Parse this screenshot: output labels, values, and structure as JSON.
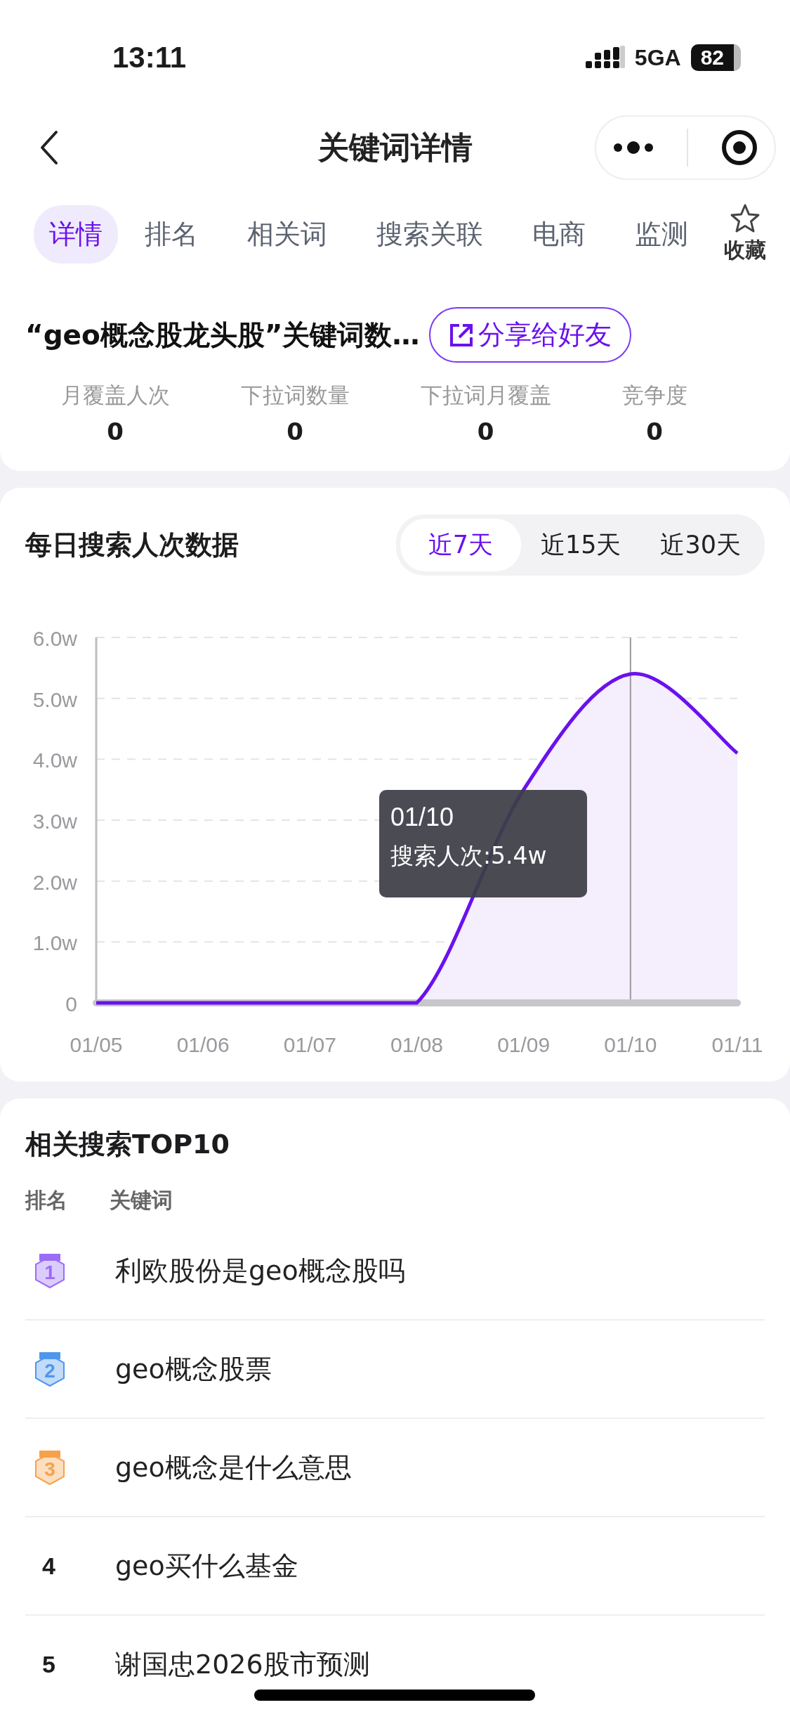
{
  "status_bar": {
    "time": "13:11",
    "network": "5GA",
    "battery": "82"
  },
  "nav": {
    "title": "关键词详情"
  },
  "tabs": [
    {
      "label": "详情",
      "selected": true
    },
    {
      "label": "排名",
      "selected": false
    },
    {
      "label": "相关词",
      "selected": false
    },
    {
      "label": "搜索关联",
      "selected": false
    },
    {
      "label": "电商",
      "selected": false
    },
    {
      "label": "监测",
      "selected": false
    }
  ],
  "favorite": {
    "label": "收藏",
    "on": false
  },
  "summary": {
    "title": "“geo概念股龙头股”关键词数…",
    "share_button": "分享给好友",
    "stats": [
      {
        "label": "月覆盖人次",
        "value": "0"
      },
      {
        "label": "下拉词数量",
        "value": "0"
      },
      {
        "label": "下拉词月覆盖",
        "value": "0"
      },
      {
        "label": "竞争度",
        "value": "0"
      }
    ]
  },
  "daily": {
    "title": "每日搜索人次数据",
    "periods": [
      {
        "label": "近7天",
        "selected": true
      },
      {
        "label": "近15天",
        "selected": false
      },
      {
        "label": "近30天",
        "selected": false
      }
    ],
    "tooltip": {
      "title": "01/10",
      "text": "搜索人次:5.4w"
    },
    "chart_data": {
      "type": "area",
      "categories": [
        "01/05",
        "01/06",
        "01/07",
        "01/08",
        "01/09",
        "01/10",
        "01/11"
      ],
      "series": [
        {
          "color": "#6a11ee",
          "values": [
            0,
            0,
            0,
            0,
            3.5,
            5.4,
            4.1
          ]
        }
      ],
      "grid": true,
      "ref_lines": [
        {
          "axis": "x",
          "value": "01/10"
        }
      ],
      "ylim": [
        0,
        6
      ],
      "yticks": [
        {
          "value": 0,
          "label": "0"
        },
        {
          "value": 1,
          "label": "1.0w"
        },
        {
          "value": 2,
          "label": "2.0w"
        },
        {
          "value": 3,
          "label": "3.0w"
        },
        {
          "value": 4,
          "label": "4.0w"
        },
        {
          "value": 5,
          "label": "5.0w"
        },
        {
          "value": 6,
          "label": "6.0w"
        }
      ]
    }
  },
  "related": {
    "title": "相关搜索TOP10",
    "columns": [
      "排名",
      "关键词"
    ],
    "rows": [
      {
        "kind": "medal",
        "rank": "1",
        "color": "#9b6cf5",
        "keyword": "利欧股份是geo概念股吗"
      },
      {
        "kind": "medal",
        "rank": "2",
        "color": "#4f97ec",
        "keyword": "geo概念股票"
      },
      {
        "kind": "medal",
        "rank": "3",
        "color": "#f7a14a",
        "keyword": "geo概念是什么意思"
      },
      {
        "kind": "number",
        "rank": "4",
        "keyword": "geo买什么基金"
      },
      {
        "kind": "number",
        "rank": "5",
        "keyword": "谢国忠2026股市预测"
      }
    ]
  }
}
